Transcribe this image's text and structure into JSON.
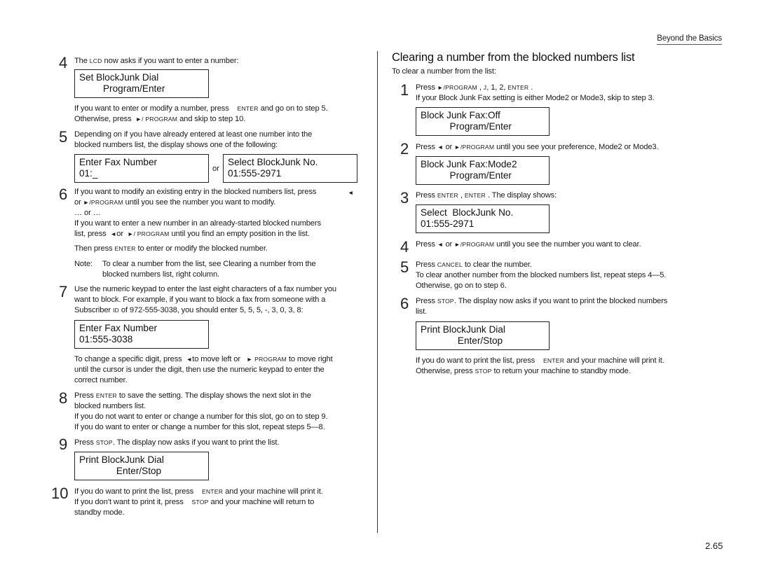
{
  "header": {
    "section_label": "Beyond the Basics"
  },
  "page_number": "2.65",
  "left_column": {
    "step4": {
      "number": "4",
      "line1_a": "The ",
      "line1_lcd": "LCD",
      "line1_b": " now asks if you want to enter a number:",
      "lcd_line1": "Set BlockJunk Dial",
      "lcd_line2": "         Program/Enter",
      "after1_a": "If you want to enter or modify a number, press ",
      "after1_key": "ENTER",
      "after1_b": " and go on to step 5.",
      "after2_a": "Otherwise, press ",
      "after2_key": "►/ PROGRAM",
      "after2_b": " and skip to step 10."
    },
    "step5": {
      "number": "5",
      "line1": "Depending on if you have already entered at least one number into the",
      "line2": "blocked numbers list, the display shows one of the following:",
      "lcd_a_line1": "Enter Fax Number",
      "lcd_a_line2": "01:_",
      "or_label": "or",
      "lcd_b_line1": "Select BlockJunk No.",
      "lcd_b_line2": "01:555-2971"
    },
    "step6": {
      "number": "6",
      "line1": "If you want to modify an existing entry in the blocked numbers list, press",
      "line1_key": "◄",
      "line2_a": "or ",
      "line2_key": "►/PROGRAM",
      "line2_b": " until you see the number you want to modify.",
      "line3": "… or …",
      "line4": "If you want to enter a new number in an already-started blocked numbers",
      "line5_a": "list, press ",
      "line5_key1": "◄",
      "line5_or": "or ",
      "line5_key2": "►/ PROGRAM",
      "line5_b": " until you find an empty position in the list.",
      "line6_a": "Then press ",
      "line6_key": "ENTER",
      "line6_b": " to enter or modify the blocked number.",
      "note_label": "Note:",
      "note_line1": "To clear a number from the list, see  Clearing a number from the",
      "note_line2": "blocked numbers list,  right column."
    },
    "step7": {
      "number": "7",
      "line1": "Use the numeric keypad to enter   the last eight characters  of a fax number you",
      "line2": "want to block. For example, if you want to block a fax from someone with a",
      "line3_a": "Subscriber ",
      "line3_key": "ID",
      "line3_b": " of 972-555-3038, you should enter  5, 5, 5, -, 3, 0, 3, 8:",
      "lcd_line1": "Enter Fax Number",
      "lcd_line2": "01:555-3038",
      "after1_a": "To change a specific digit, press ",
      "after1_key1": "◄",
      "after1_b": "to move left or ",
      "after1_key2": "► PROGRAM",
      "after1_c": " to move right",
      "after2": "until the cursor is under the digit, then use the numeric keypad to enter the",
      "after3": "correct number."
    },
    "step8": {
      "number": "8",
      "line1_a": "Press ",
      "line1_key": "ENTER",
      "line1_b": " to save the setting. The display shows the next  slot  in the",
      "line2": "blocked numbers list.",
      "line3": "If you  do not want to enter or change a number for this slot, go on to step 9.",
      "line4": "If you  do want to enter or change a number for this slot, repeat steps 5—8."
    },
    "step9": {
      "number": "9",
      "line1_a": "Press ",
      "line1_key": "STOP",
      "line1_b": ". The display now asks if you want to print the list.",
      "lcd_line1": "Print BlockJunk Dial",
      "lcd_line2": "              Enter/Stop"
    },
    "step10": {
      "number": "10",
      "line1_a": "If you  do want to print the list, press ",
      "line1_key": "ENTER",
      "line1_b": " and your machine will print it.",
      "line2_a": "If you  don’t want to print it, press ",
      "line2_key": "STOP",
      "line2_b": " and your machine will return to",
      "line3": "standby mode."
    }
  },
  "right_column": {
    "title": "Clearing a number from the blocked numbers list",
    "intro": "To clear a number from the list:",
    "step1": {
      "number": "1",
      "line1_a": "Press ",
      "line1_key1": "►/PROGRAM",
      "line1_b": " , ",
      "line1_key2": "J",
      "line1_c": ", 1, 2, ",
      "line1_key3": "ENTER",
      "line1_d": " .",
      "line2": "If your Block Junk Fax setting is either     Mode2 or Mode3, skip to step 3.",
      "lcd_line1": "Block Junk Fax:Off",
      "lcd_line2": "           Program/Enter"
    },
    "step2": {
      "number": "2",
      "line1_a": "Press ",
      "line1_key1": "◄",
      "line1_b": " or ",
      "line1_key2": "►/PROGRAM",
      "line1_c": "  until you see your preference,   Mode2 or Mode3.",
      "lcd_line1": "Block Junk Fax:Mode2",
      "lcd_line2": "           Program/Enter"
    },
    "step3": {
      "number": "3",
      "line1_a": "Press ",
      "line1_key1": "ENTER",
      "line1_b": " , ",
      "line1_key2": "ENTER",
      "line1_c": " . The display shows:",
      "lcd_line1": "Select  BlockJunk No.",
      "lcd_line2": "01:555-2971"
    },
    "step4": {
      "number": "4",
      "line1_a": "Press ",
      "line1_key1": "◄",
      "line1_b": " or ",
      "line1_key2": "►/PROGRAM",
      "line1_c": "  until you see the number you want to clear."
    },
    "step5": {
      "number": "5",
      "line1_a": "Press ",
      "line1_key": "CANCEL",
      "line1_b": "  to clear the number.",
      "line2": "To clear another number from the blocked numbers list, repeat steps 4—5.",
      "line3": "Otherwise, go on to step 6."
    },
    "step6": {
      "number": "6",
      "line1_a": "Press ",
      "line1_key": "STOP",
      "line1_b": ". The display now asks if you want to print the blocked numbers",
      "line2": "list.",
      "lcd_line1": "Print BlockJunk Dial",
      "lcd_line2": "              Enter/Stop",
      "after1_a": "If you  do want to print the list, press ",
      "after1_key": "ENTER",
      "after1_b": "  and your machine will print it.",
      "after2_a": "Otherwise, press ",
      "after2_key": "STOP",
      "after2_b": "  to return your machine to standby mode."
    }
  }
}
